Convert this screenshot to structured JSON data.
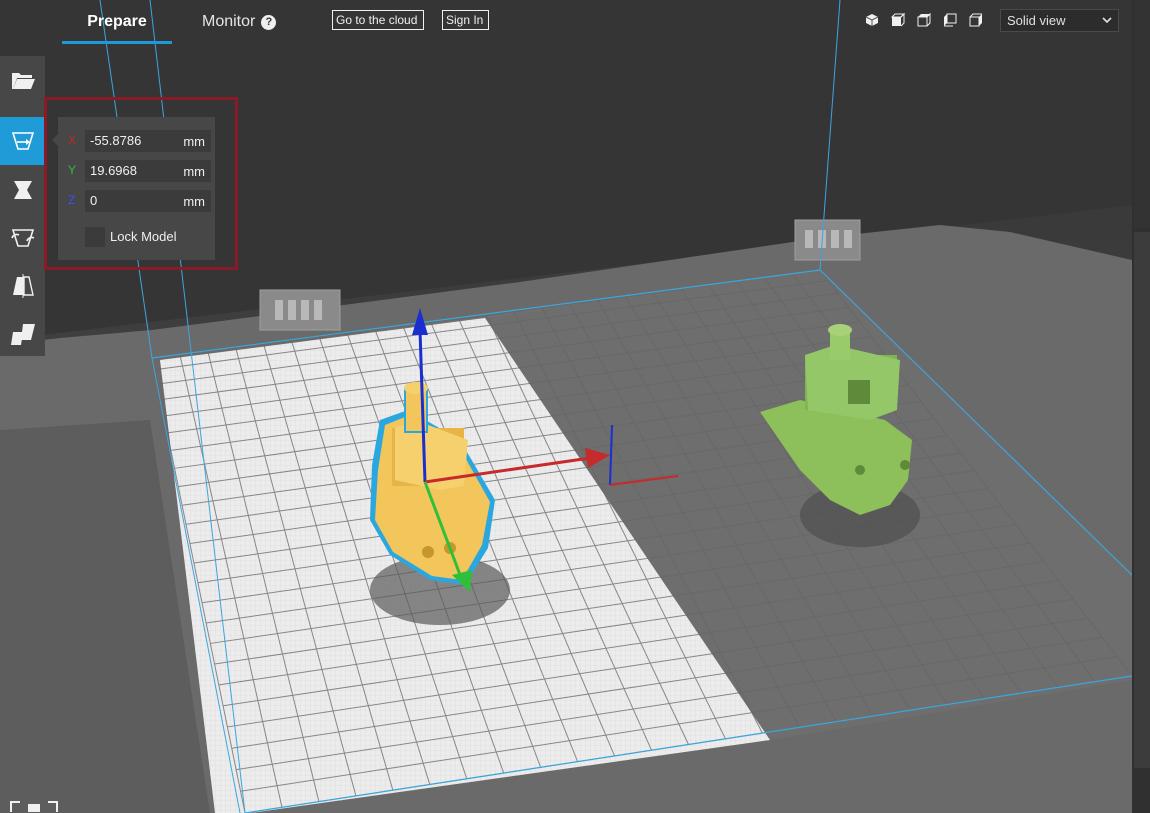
{
  "tabs": {
    "prepare": "Prepare",
    "monitor": "Monitor"
  },
  "header_buttons": {
    "cloud": "Go to the cloud",
    "sign_in": "Sign In"
  },
  "view_mode": {
    "selected": "Solid view",
    "icons": [
      "cube-3d-view-icon",
      "front-view-icon",
      "top-view-icon",
      "left-view-icon",
      "right-view-icon"
    ]
  },
  "toolbar": {
    "tools": [
      "open-file-icon",
      "move-icon",
      "scale-icon",
      "rotate-icon",
      "mirror-icon",
      "per-model-settings-icon"
    ],
    "active_tool": "move-icon"
  },
  "move_panel": {
    "x_label": "X",
    "x_value": "-55.8786",
    "y_label": "Y",
    "y_value": "19.6968",
    "z_label": "Z",
    "z_value": "0",
    "unit": "mm",
    "lock_label": "Lock Model"
  },
  "colors": {
    "accent": "#1f9bd8",
    "selected_model": "#f2c65a",
    "other_model": "#8fc25b",
    "axis_x": "#c62a2a",
    "axis_y": "#2fbf3a",
    "axis_z": "#1b2fd1",
    "highlight_frame": "#8b1a27"
  }
}
